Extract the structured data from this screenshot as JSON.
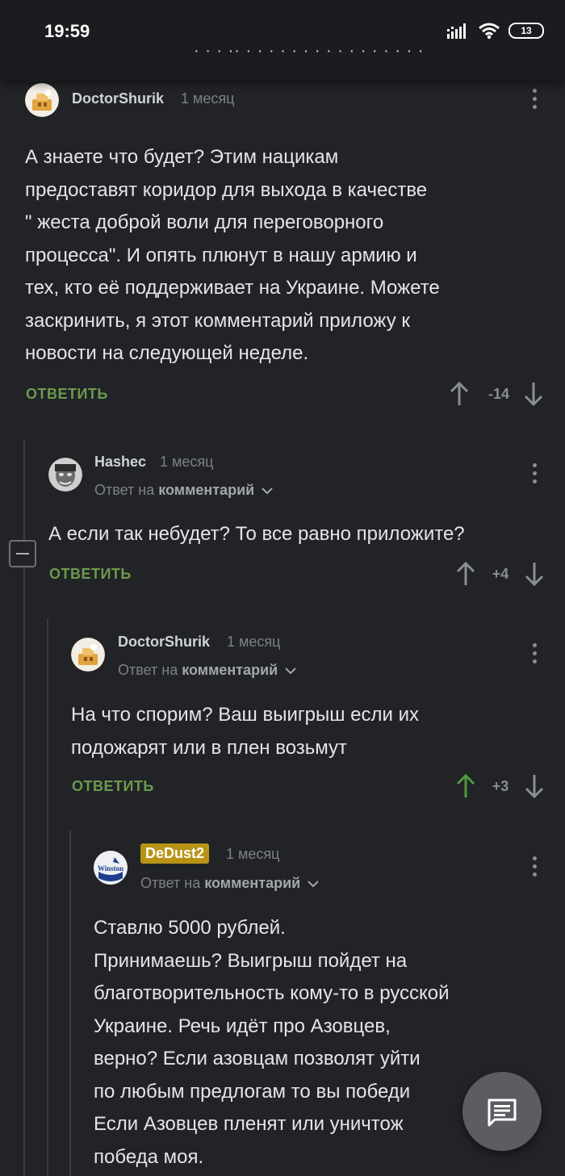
{
  "status_bar": {
    "time": "19:59",
    "battery": "13"
  },
  "comments": [
    {
      "username": "DoctorShurik",
      "date": "1 месяц",
      "text_lines": [
        "А знаете  что будет? Этим нацикам",
        "предоставят коридор для выхода в качестве",
        "\" жеста доброй воли  для переговорного",
        "процесса\".  И опять плюнут в нашу армию и",
        "тех, кто её поддерживает на Украине. Можете",
        "заскринить, я этот комментарий приложу к",
        "новости  на следующей неделе."
      ],
      "reply_label": "ОТВЕТИТЬ",
      "score": "-14"
    },
    {
      "username": "Hashec",
      "date": "1 месяц",
      "reply_to_prefix": "Ответ на",
      "reply_to_target": "комментарий",
      "text_lines": [
        "А если так небудет? То все равно приложите?"
      ],
      "reply_label": "ОТВЕТИТЬ",
      "score": "+4"
    },
    {
      "username": "DoctorShurik",
      "date": "1 месяц",
      "reply_to_prefix": "Ответ на",
      "reply_to_target": "комментарий",
      "text_lines": [
        "На что спорим? Ваш выигрыш если их",
        "подожарят или в плен возьмут"
      ],
      "reply_label": "ОТВЕТИТЬ",
      "score": "+3"
    },
    {
      "username": "DeDust2",
      "avatar_text": "Winston",
      "date": "1 месяц",
      "reply_to_prefix": "Ответ на",
      "reply_to_target": "комментарий",
      "text_lines": [
        "Ставлю 5000 рублей.",
        "Принимаешь? Выигрыш пойдет на",
        "благотворительность кому-то в русской",
        "Украине. Речь идёт про Азовцев,",
        "верно? Если азовцам позволят уйти",
        "по любым предлогам то вы победи",
        "Если Азовцев пленят или уничтож",
        "победа моя."
      ]
    }
  ],
  "colors": {
    "background": "#212327",
    "reply_green": "#6b9a4c",
    "upvoted_green": "#4f9a3f",
    "badge_gold": "#b89416"
  },
  "icons": [
    "signal-icon",
    "wifi-icon",
    "battery-icon",
    "kebab-menu-icon",
    "arrow-up-icon",
    "arrow-down-icon",
    "chevron-down-icon",
    "collapse-icon",
    "comment-fab-icon"
  ]
}
